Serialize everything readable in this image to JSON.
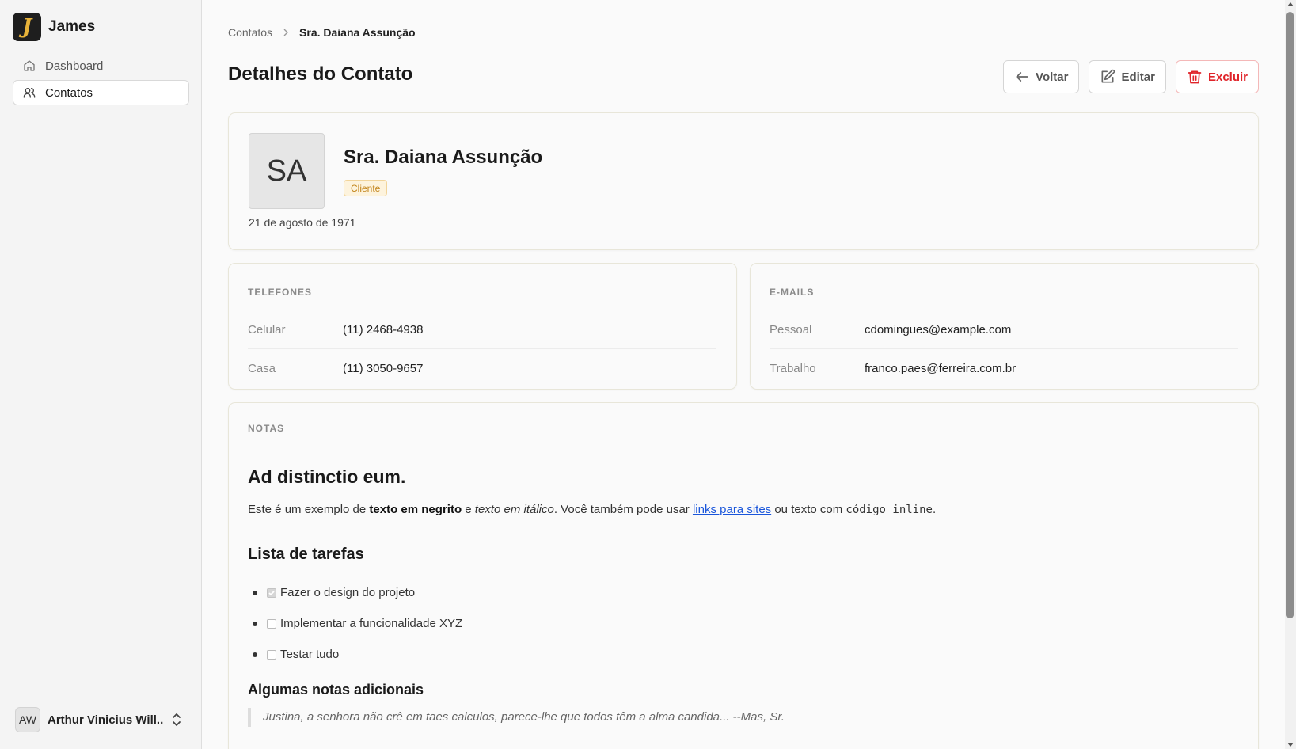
{
  "app": {
    "name": "James",
    "logo_letter": "J"
  },
  "sidebar": {
    "items": [
      {
        "label": "Dashboard",
        "icon": "home-icon",
        "active": false
      },
      {
        "label": "Contatos",
        "icon": "users-icon",
        "active": true
      }
    ],
    "user": {
      "initials": "AW",
      "name": "Arthur Vinicius Will..."
    }
  },
  "breadcrumb": {
    "parent": "Contatos",
    "current": "Sra. Daiana Assunção"
  },
  "page": {
    "title": "Detalhes do Contato",
    "actions": {
      "back": "Voltar",
      "edit": "Editar",
      "delete": "Excluir"
    }
  },
  "contact": {
    "initials": "SA",
    "name": "Sra. Daiana Assunção",
    "badge": "Cliente",
    "birth_date": "21 de agosto de 1971"
  },
  "phones": {
    "label": "TELEFONES",
    "items": [
      {
        "label": "Celular",
        "value": "(11) 2468-4938"
      },
      {
        "label": "Casa",
        "value": "(11) 3050-9657"
      }
    ]
  },
  "emails": {
    "label": "E-MAILS",
    "items": [
      {
        "label": "Pessoal",
        "value": "cdomingues@example.com"
      },
      {
        "label": "Trabalho",
        "value": "franco.paes@ferreira.com.br"
      }
    ]
  },
  "notes": {
    "label": "NOTAS",
    "heading": "Ad distinctio eum.",
    "paragraph": {
      "p1": "Este é um exemplo de ",
      "bold": "texto em negrito",
      "p2": " e ",
      "italic": "texto em itálico",
      "p3": ". Você também pode usar ",
      "link": "links para sites",
      "p4": " ou texto com ",
      "code": "código inline",
      "p5": "."
    },
    "tasks_heading": "Lista de tarefas",
    "tasks": [
      {
        "label": "Fazer o design do projeto",
        "checked": true
      },
      {
        "label": "Implementar a funcionalidade XYZ",
        "checked": false
      },
      {
        "label": "Testar tudo",
        "checked": false
      }
    ],
    "additional_heading": "Algumas notas adicionais",
    "quote": "Justina, a senhora não crê em taes calculos, parece-lhe que todos têm a alma candida... --Mas, Sr."
  },
  "colors": {
    "accent_danger": "#e0242a",
    "badge_text": "#c2841a",
    "link": "#1a56db",
    "logo_gold": "#e8b33a"
  }
}
